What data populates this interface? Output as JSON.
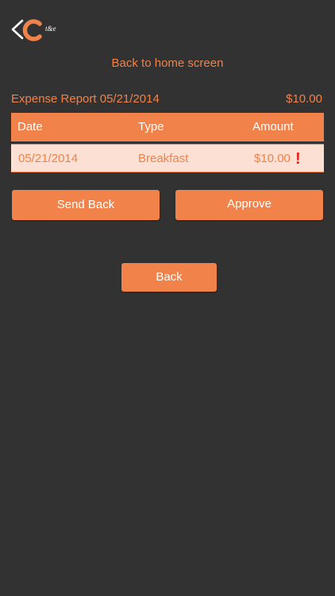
{
  "header": {
    "logo_tagline": "t&e"
  },
  "home_link": "Back to home screen",
  "report": {
    "title": "Expense Report 05/21/2014",
    "total": "$10.00"
  },
  "table": {
    "columns": [
      "Date",
      "Type",
      "Amount"
    ],
    "rows": [
      {
        "date": "05/21/2014",
        "type": "Breakfast",
        "amount": "$10.00",
        "alert": "!"
      }
    ]
  },
  "actions": {
    "send_back": "Send Back",
    "approve": "Approve",
    "back": "Back"
  },
  "colors": {
    "background": "#323232",
    "accent": "#f0824a",
    "row_bg": "#fde0d4",
    "alert": "#e8201a"
  },
  "icons": {
    "logo": "back-chevron-logo-icon",
    "row_alert": "exclamation-icon"
  }
}
